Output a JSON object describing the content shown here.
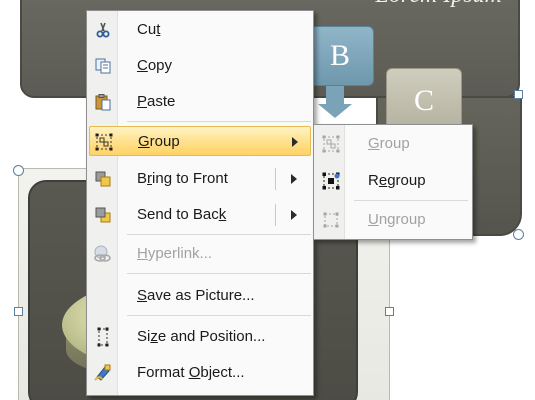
{
  "slide": {
    "heading": "Lorem Ipsum",
    "box_b": "B",
    "box_c": "C"
  },
  "context_menu": {
    "items": [
      {
        "label": "Cut",
        "accel": "t",
        "icon": "scissors-icon",
        "enabled": true
      },
      {
        "label": "Copy",
        "accel": "C",
        "icon": "copy-icon",
        "enabled": true
      },
      {
        "label": "Paste",
        "accel": "P",
        "icon": "paste-icon",
        "enabled": true
      },
      {
        "label": "Group",
        "accel": "G",
        "icon": "group-icon",
        "enabled": true,
        "submenu": true,
        "highlighted": true
      },
      {
        "label": "Bring to Front",
        "accel": "r",
        "icon": "bring-to-front-icon",
        "enabled": true,
        "submenu": true
      },
      {
        "label": "Send to Back",
        "accel": "k",
        "icon": "send-to-back-icon",
        "enabled": true,
        "submenu": true
      },
      {
        "label": "Hyperlink...",
        "accel": "H",
        "icon": "hyperlink-icon",
        "enabled": false
      },
      {
        "label": "Save as Picture...",
        "accel": "S",
        "icon": "",
        "enabled": true
      },
      {
        "label": "Size and Position...",
        "accel": "z",
        "icon": "size-position-icon",
        "enabled": true
      },
      {
        "label": "Format Object...",
        "accel": "O",
        "icon": "format-object-icon",
        "enabled": true
      }
    ]
  },
  "group_submenu": {
    "items": [
      {
        "label": "Group",
        "accel": "G",
        "icon": "group-icon",
        "enabled": false
      },
      {
        "label": "Regroup",
        "accel": "e",
        "icon": "regroup-icon",
        "enabled": true
      },
      {
        "label": "Ungroup",
        "accel": "U",
        "icon": "ungroup-icon",
        "enabled": false
      }
    ]
  },
  "colors": {
    "highlight": "#ffe08a",
    "disabled_text": "#a2a2a2",
    "slide_dark": "#5c5c55",
    "box_b": "#7aa3b7",
    "box_c": "#c2c0ae"
  }
}
